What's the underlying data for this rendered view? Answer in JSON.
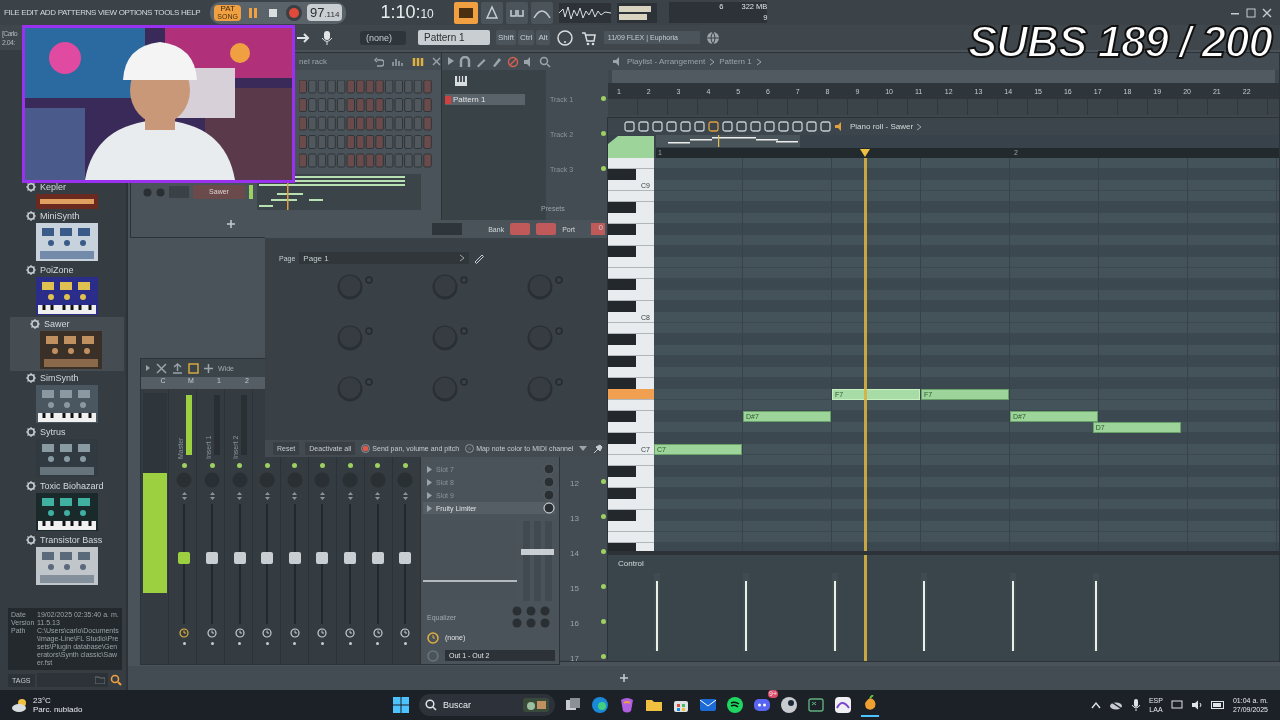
{
  "menu": [
    "FILE",
    "EDIT",
    "ADD",
    "PATTERNS",
    "VIEW",
    "OPTIONS",
    "TOOLS",
    "HELP"
  ],
  "transport": {
    "pattern_mode": true,
    "mode": "PAT",
    "mode_alt": "SONG",
    "tempo": "97",
    "tempo_fraction": ".114",
    "time": "1:10:",
    "time_small": "10",
    "cpu": "6",
    "memory": "322 MB",
    "polyphony": "9"
  },
  "hint_bar": {
    "title": "[Carlo",
    "time": "2.04:"
  },
  "toolbar": {
    "pattern_selector": "(none)",
    "pattern": "Pattern 1",
    "keys": [
      "Shift",
      "Ctrl",
      "Alt"
    ],
    "news": "11/09  FLEX | Euphoria"
  },
  "overlay_title": "SUBS 189 / 200",
  "browser": {
    "items": [
      {
        "name": "Kepler",
        "selected": false
      },
      {
        "name": "MiniSynth",
        "selected": false
      },
      {
        "name": "PoiZone",
        "selected": false
      },
      {
        "name": "Sawer",
        "selected": true
      },
      {
        "name": "SimSynth",
        "selected": false
      },
      {
        "name": "Sytrus",
        "selected": false
      },
      {
        "name": "Toxic Biohazard",
        "selected": false
      },
      {
        "name": "Transistor Bass",
        "selected": false
      }
    ],
    "info": [
      {
        "label": "Date",
        "value": "19/02/2025 02:35:40 a. m."
      },
      {
        "label": "Version",
        "value": "11.5.13"
      },
      {
        "label": "Path",
        "value": "C:\\Users\\carlo\\Documents\\Image-Line\\FL Studio\\Presets\\Plugin database\\Generators\\Synth classic\\Sawer.fst"
      }
    ],
    "tags_label": "TAGS"
  },
  "channel_rack": {
    "title": "nel rack",
    "channel": "Sawer"
  },
  "playlist": {
    "title": "Playlist - Arrangement",
    "pattern": "Pattern 1",
    "patterns": [
      {
        "name": "Pattern 1",
        "selected": true
      }
    ],
    "tracks": [
      "Track 1",
      "Track 2",
      "Track 3"
    ],
    "track_numbers": [
      "12",
      "13",
      "14",
      "15",
      "16",
      "17"
    ],
    "presets_label": "Presets",
    "bars": [
      "1",
      "2",
      "3",
      "4",
      "5",
      "6",
      "7",
      "8",
      "9",
      "10",
      "11",
      "12",
      "13",
      "14",
      "15",
      "16",
      "17",
      "18",
      "19",
      "20",
      "21",
      "22"
    ]
  },
  "wrapper": {
    "bank_label": "Bank",
    "port_label": "Port",
    "port": "0",
    "page_label": "Page",
    "page": "Page 1",
    "buttons": [
      "Reset",
      "Deactivate all"
    ],
    "options": [
      {
        "label": "Send pan, volume and pitch",
        "checked": true
      },
      {
        "label": "Map note color to MIDI channel",
        "checked": false
      }
    ]
  },
  "mixer": {
    "mode": "Wide",
    "headers": [
      "C",
      "M",
      "1",
      "2"
    ],
    "master_meter": {
      "level": 0.6
    },
    "strips": [
      {
        "name": "Master",
        "selected": true,
        "level": 0.55
      },
      {
        "name": "Insert 1",
        "selected": false,
        "level": 0.55
      },
      {
        "name": "Insert 2",
        "selected": false,
        "level": 0.55
      },
      {
        "selected": false,
        "level": 0.55
      },
      {
        "selected": false,
        "level": 0.55
      },
      {
        "selected": false,
        "level": 0.55
      },
      {
        "selected": false,
        "level": 0.55
      },
      {
        "selected": false,
        "level": 0.55
      },
      {
        "selected": false,
        "level": 0.55
      }
    ],
    "slots": [
      {
        "name": "Slot 7",
        "filled": false
      },
      {
        "name": "Slot 8",
        "filled": false
      },
      {
        "name": "Slot 9",
        "filled": false
      },
      {
        "name": "Fruity Limiter",
        "filled": true
      }
    ],
    "eq_label": "Equalizer",
    "input": "(none)",
    "output": "Out 1 - Out 2"
  },
  "piano_roll": {
    "title": "Piano roll - Sawer",
    "ruler": [
      "1",
      "2"
    ],
    "key_labels": [
      "C9",
      "C8",
      "C7"
    ],
    "control_label": "Control",
    "notes": [
      {
        "label": "C7",
        "playing": false,
        "level": 0.9
      },
      {
        "label": "D#7",
        "playing": false,
        "level": 0.9
      },
      {
        "label": "F7",
        "playing": true,
        "level": 0.9
      },
      {
        "label": "F7",
        "playing": false,
        "level": 0.9
      },
      {
        "label": "D#7",
        "playing": false,
        "level": 0.9
      },
      {
        "label": "D7",
        "playing": false,
        "level": 0.9
      }
    ]
  },
  "taskbar": {
    "temperature": "23°C",
    "weather": "Parc. nublado",
    "search": "Buscar",
    "badge": "9+",
    "language": "ESP",
    "layout": "LAA",
    "time": "01:04 a. m.",
    "date": "27/09/2025"
  }
}
